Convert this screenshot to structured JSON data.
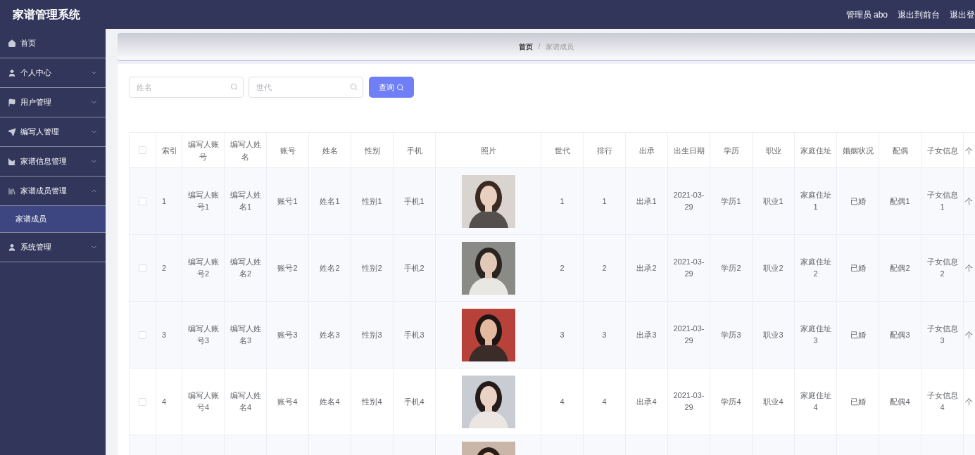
{
  "app_title": "家谱管理系统",
  "user_label": "管理员 abo",
  "header_links": [
    "退出到前台",
    "退出登"
  ],
  "sidebar": {
    "items": [
      {
        "label": "首页",
        "kind": "link"
      },
      {
        "label": "个人中心",
        "kind": "menu",
        "expanded": false
      },
      {
        "label": "用户管理",
        "kind": "menu",
        "expanded": false
      },
      {
        "label": "编写人管理",
        "kind": "menu",
        "expanded": false
      },
      {
        "label": "家谱信息管理",
        "kind": "menu",
        "expanded": false
      },
      {
        "label": "家谱成员管理",
        "kind": "menu",
        "expanded": true,
        "children": [
          {
            "label": "家谱成员",
            "selected": true
          }
        ]
      },
      {
        "label": "系统管理",
        "kind": "menu",
        "expanded": false
      }
    ]
  },
  "breadcrumb": [
    "首页",
    "/",
    "家谱成员"
  ],
  "search": {
    "fields": [
      {
        "placeholder": "姓名"
      },
      {
        "placeholder": "世代"
      }
    ],
    "button": "查询"
  },
  "table": {
    "select_all": {
      "checked": false
    },
    "columns": [
      {
        "label": "索引",
        "kind": "narrow"
      },
      {
        "label": "编写人账号",
        "kind": "text"
      },
      {
        "label": "编写人姓名",
        "kind": "text"
      },
      {
        "label": "账号",
        "kind": "text"
      },
      {
        "label": "姓名",
        "kind": "text"
      },
      {
        "label": "性别",
        "kind": "text"
      },
      {
        "label": "手机",
        "kind": "text"
      },
      {
        "label": "照片"
      },
      {
        "label": "世代",
        "kind": "text"
      },
      {
        "label": "排行",
        "kind": "text"
      },
      {
        "label": "出承",
        "kind": "text"
      },
      {
        "label": "出生日期",
        "kind": "text"
      },
      {
        "label": "学历",
        "kind": "text"
      },
      {
        "label": "职业",
        "kind": "text"
      },
      {
        "label": "家庭住址",
        "kind": "text"
      },
      {
        "label": "婚姻状况",
        "kind": "text"
      },
      {
        "label": "配偶",
        "kind": "text"
      },
      {
        "label": "子女信息",
        "kind": "text"
      },
      {
        "label": "个",
        "kind": "cut"
      }
    ],
    "rows": [
      {
        "checked": false,
        "cells": [
          "1",
          "编写人账号1",
          "编写人姓名1",
          "账号1",
          "姓名1",
          "性别1",
          "手机1",
          {
            "kind": "picture"
          },
          "1",
          "1",
          "出承1",
          "2021-03-29",
          "学历1",
          "职业1",
          "家庭住址1",
          "已婚",
          "配偶1",
          "子女信息1",
          "个"
        ]
      },
      {
        "checked": false,
        "cells": [
          "2",
          "编写人账号2",
          "编写人姓名2",
          "账号2",
          "姓名2",
          "性别2",
          "手机2",
          {
            "kind": "picture"
          },
          "2",
          "2",
          "出承2",
          "2021-03-29",
          "学历2",
          "职业2",
          "家庭住址2",
          "已婚",
          "配偶2",
          "子女信息2",
          "个"
        ]
      },
      {
        "checked": false,
        "cells": [
          "3",
          "编写人账号3",
          "编写人姓名3",
          "账号3",
          "姓名3",
          "性别3",
          "手机3",
          {
            "kind": "picture"
          },
          "3",
          "3",
          "出承3",
          "2021-03-29",
          "学历3",
          "职业3",
          "家庭住址3",
          "已婚",
          "配偶3",
          "子女信息3",
          "个"
        ]
      },
      {
        "checked": false,
        "cells": [
          "4",
          "编写人账号4",
          "编写人姓名4",
          "账号4",
          "姓名4",
          "性别4",
          "手机4",
          {
            "kind": "picture"
          },
          "4",
          "4",
          "出承4",
          "2021-03-29",
          "学历4",
          "职业4",
          "家庭住址4",
          "已婚",
          "配偶4",
          "子女信息4",
          "个"
        ]
      },
      {
        "cells": [
          null,
          null,
          null,
          null,
          null,
          null,
          null,
          {
            "kind": "picture"
          },
          null,
          null,
          null,
          null,
          null,
          null,
          null,
          null,
          null,
          null,
          null
        ]
      }
    ]
  }
}
